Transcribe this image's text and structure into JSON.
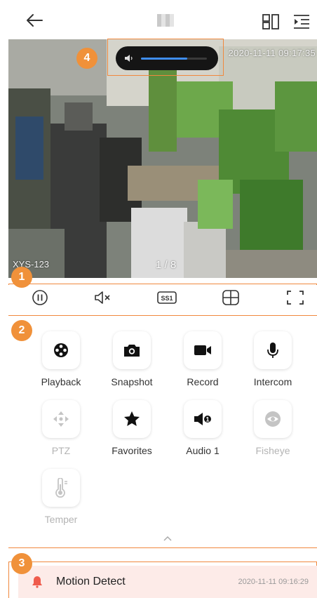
{
  "header": {
    "title": ""
  },
  "video": {
    "timestamp": "2020-11-11 09:17:35",
    "channel_name": "XYS-123",
    "page_indicator": "1 / 8",
    "volume_level": 0.7,
    "volume_color": "#3f8ef0"
  },
  "annotations": {
    "b1": "1",
    "b2": "2",
    "b3": "3",
    "b4": "4",
    "color": "#f0883e"
  },
  "controls": [
    {
      "name": "pause-icon"
    },
    {
      "name": "mute-icon"
    },
    {
      "name": "stream-ss1-icon",
      "label": "SS1"
    },
    {
      "name": "split-screen-icon"
    },
    {
      "name": "fullscreen-icon"
    }
  ],
  "actions": [
    {
      "label": "Playback",
      "icon": "playback-reel-icon",
      "enabled": true
    },
    {
      "label": "Snapshot",
      "icon": "camera-icon",
      "enabled": true
    },
    {
      "label": "Record",
      "icon": "video-camera-icon",
      "enabled": true
    },
    {
      "label": "Intercom",
      "icon": "microphone-icon",
      "enabled": true
    },
    {
      "label": "PTZ",
      "icon": "ptz-arrows-icon",
      "enabled": false
    },
    {
      "label": "Favorites",
      "icon": "star-icon",
      "enabled": true
    },
    {
      "label": "Audio 1",
      "icon": "speaker-icon",
      "enabled": true
    },
    {
      "label": "Fisheye",
      "icon": "fisheye-icon",
      "enabled": false
    },
    {
      "label": "Temper",
      "icon": "thermometer-icon",
      "enabled": false
    }
  ],
  "alarm": {
    "event": "Motion Detect",
    "time": "2020-11-11 09:16:29"
  }
}
